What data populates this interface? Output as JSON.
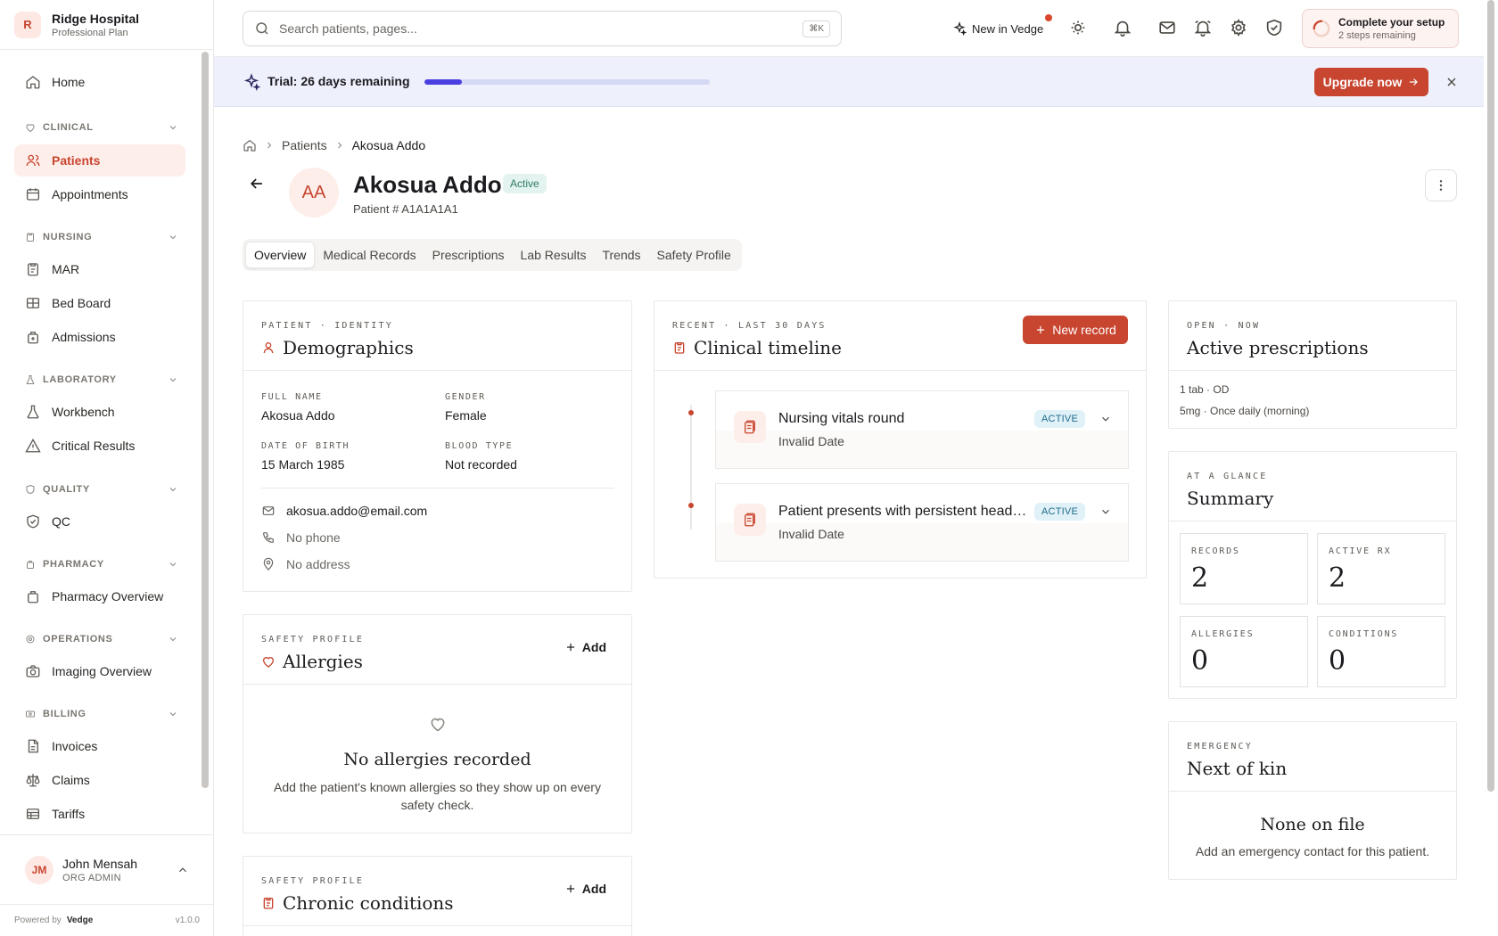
{
  "org": {
    "initial": "R",
    "name": "Ridge Hospital",
    "plan": "Professional Plan"
  },
  "sidebar": {
    "home": "Home",
    "sections": {
      "clinical": "CLINICAL",
      "nursing": "NURSING",
      "laboratory": "LABORATORY",
      "quality": "QUALITY",
      "pharmacy": "PHARMACY",
      "operations": "OPERATIONS",
      "billing": "BILLING"
    },
    "items": {
      "patients": "Patients",
      "appointments": "Appointments",
      "mar": "MAR",
      "bed_board": "Bed Board",
      "admissions": "Admissions",
      "workbench": "Workbench",
      "critical_results": "Critical Results",
      "qc": "QC",
      "pharmacy_overview": "Pharmacy Overview",
      "imaging_overview": "Imaging Overview",
      "invoices": "Invoices",
      "claims": "Claims",
      "tariffs": "Tariffs"
    },
    "active_item": "patients"
  },
  "user": {
    "initials": "JM",
    "name": "John Mensah",
    "role": "ORG ADMIN"
  },
  "footer": {
    "powered_by": "Powered by",
    "brand": "Vedge",
    "version": "v1.0.0"
  },
  "topbar": {
    "search_placeholder": "Search patients, pages...",
    "shortcut": "⌘K",
    "new_in": "New in Vedge",
    "setup_title": "Complete your setup",
    "setup_sub": "2 steps remaining"
  },
  "trial": {
    "text": "Trial: 26 days remaining",
    "progress": 0.13,
    "upgrade_label": "Upgrade now"
  },
  "breadcrumb": {
    "parent": "Patients",
    "current": "Akosua Addo"
  },
  "patient": {
    "initials": "AA",
    "name": "Akosua Addo",
    "status": "Active",
    "number": "Patient # A1A1A1A1"
  },
  "tabs": [
    "Overview",
    "Medical Records",
    "Prescriptions",
    "Lab Results",
    "Trends",
    "Safety Profile"
  ],
  "demographics": {
    "eyebrow": "PATIENT · IDENTITY",
    "title": "Demographics",
    "full_name_label": "FULL NAME",
    "full_name": "Akosua Addo",
    "gender_label": "GENDER",
    "gender": "Female",
    "dob_label": "DATE OF BIRTH",
    "dob": "15 March 1985",
    "blood_label": "BLOOD TYPE",
    "blood": "Not recorded",
    "email": "akosua.addo@email.com",
    "phone": "No phone",
    "address": "No address"
  },
  "allergies": {
    "eyebrow": "SAFETY PROFILE",
    "title": "Allergies",
    "add_label": "Add",
    "empty_title": "No allergies recorded",
    "empty_sub": "Add the patient's known allergies so they show up on every safety check."
  },
  "conditions": {
    "eyebrow": "SAFETY PROFILE",
    "title": "Chronic conditions",
    "add_label": "Add"
  },
  "timeline": {
    "eyebrow": "RECENT · LAST 30 DAYS",
    "title": "Clinical timeline",
    "new_label": "New record",
    "items": [
      {
        "title": "Nursing vitals round",
        "date": "Invalid Date",
        "badge": "ACTIVE"
      },
      {
        "title": "Patient presents with persistent headache and mild fever",
        "date": "Invalid Date",
        "badge": "ACTIVE"
      }
    ]
  },
  "prescriptions": {
    "eyebrow": "OPEN · NOW",
    "title": "Active prescriptions",
    "line1": "1 tab · OD",
    "line2": "5mg · Once daily (morning)"
  },
  "summary": {
    "eyebrow": "AT A GLANCE",
    "title": "Summary",
    "stats": [
      {
        "label": "RECORDS",
        "value": "2"
      },
      {
        "label": "ACTIVE RX",
        "value": "2"
      },
      {
        "label": "ALLERGIES",
        "value": "0"
      },
      {
        "label": "CONDITIONS",
        "value": "0"
      }
    ]
  },
  "kin": {
    "eyebrow": "EMERGENCY",
    "title": "Next of kin",
    "empty_title": "None on file",
    "empty_sub": "Add an emergency contact for this patient."
  },
  "colors": {
    "accent": "#c8452f",
    "trial_fill": "#4a3fe0",
    "status_active_bg": "#e3f3ef",
    "badge_bg": "#e0f1f8"
  },
  "icons": {
    "home": "home-icon",
    "search": "search-icon",
    "sparkle": "sparkle-icon",
    "sun": "sun-icon",
    "bell": "bell-icon",
    "mail": "mail-icon",
    "alarm": "alarm-icon",
    "gear": "gear-icon",
    "shield": "shield-icon",
    "close": "close-icon",
    "back": "arrow-left-icon",
    "more": "more-vertical-icon",
    "user": "user-icon",
    "heart": "heart-icon",
    "clipboard": "clipboard-icon",
    "phone": "phone-icon",
    "pin": "map-pin-icon"
  }
}
